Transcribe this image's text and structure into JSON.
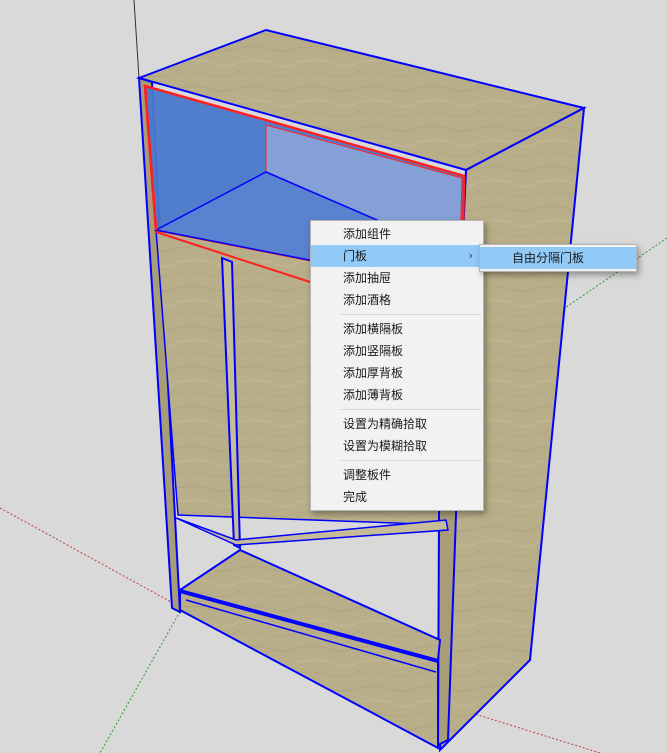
{
  "context_menu": {
    "groups": [
      [
        {
          "label": "添加组件"
        },
        {
          "label": "门板",
          "has_submenu": true,
          "highlighted": true
        },
        {
          "label": "添加抽屉"
        },
        {
          "label": "添加酒格"
        }
      ],
      [
        {
          "label": "添加横隔板"
        },
        {
          "label": "添加竖隔板"
        },
        {
          "label": "添加厚背板"
        },
        {
          "label": "添加薄背板"
        }
      ],
      [
        {
          "label": "设置为精确拾取"
        },
        {
          "label": "设置为模糊拾取"
        }
      ],
      [
        {
          "label": "调整板件"
        },
        {
          "label": "完成"
        }
      ]
    ],
    "submenu_arrow": "›"
  },
  "submenu": {
    "items": [
      {
        "label": "自由分隔门板",
        "highlighted": true
      }
    ]
  },
  "colors": {
    "background": "#d9d9d9",
    "wood": "#b9ae8a",
    "selection_blue": "#4a78cc",
    "edge_blue": "#0000ff",
    "edge_red": "#ff2020",
    "menu_highlight": "#91c9f7"
  }
}
